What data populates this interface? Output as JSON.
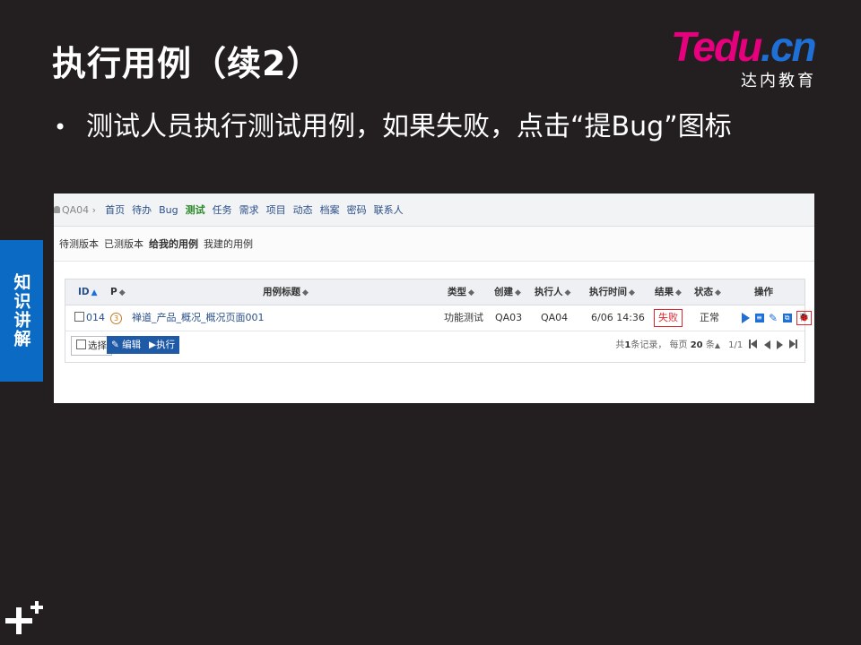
{
  "slide": {
    "title": "执行用例（续2）",
    "bullet": "测试人员执行测试用例，如果失败，点击“提Bug”图标",
    "side_tab": "知识讲解"
  },
  "logo": {
    "word_main": "Tedu",
    "word_dot": ".cn",
    "subtitle": "达内教育"
  },
  "colors": {
    "accent_blue": "#0b6bc4",
    "brand_pink": "#e6007e",
    "fail_red": "#e0282e"
  },
  "zentao": {
    "user": "QA04",
    "nav": [
      "首页",
      "待办",
      "Bug",
      "测试",
      "任务",
      "需求",
      "项目",
      "动态",
      "档案",
      "密码",
      "联系人"
    ],
    "nav_active": "测试",
    "subnav": [
      "待测版本",
      "已测版本",
      "给我的用例",
      "我建的用例"
    ],
    "subnav_active": "给我的用例",
    "columns": {
      "id": "ID",
      "pri": "P",
      "title": "用例标题",
      "type": "类型",
      "creator": "创建",
      "executor": "执行人",
      "exec_time": "执行时间",
      "result": "结果",
      "status": "状态",
      "actions": "操作"
    },
    "rows": [
      {
        "id": "014",
        "pri": "3",
        "title": "禅道_产品_概况_概况页面001",
        "type": "功能测试",
        "creator": "QA03",
        "executor": "QA04",
        "exec_time": "6/06 14:36",
        "result": "失败",
        "status": "正常"
      }
    ],
    "actions_icons": [
      "run-icon",
      "results-icon",
      "edit-icon",
      "copy-icon",
      "create-bug-icon"
    ],
    "buttons": {
      "select": "选择",
      "edit": "编辑",
      "execute": "执行"
    },
    "pager": {
      "prefix": "共",
      "total": "1",
      "suffix": "条记录，",
      "per_page_prefix": "每页",
      "per_page": "20",
      "per_page_suffix": "条",
      "pages": "1/1"
    }
  }
}
